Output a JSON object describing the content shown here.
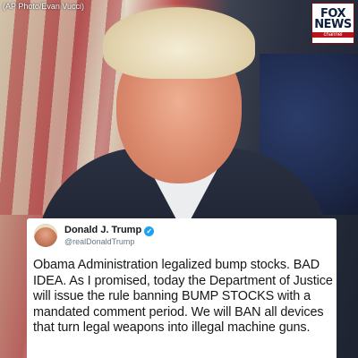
{
  "photo_credit": "(AP Photo/Evan Vucci)",
  "logo": {
    "word": "FOX\nNEWS",
    "line1": "FOX",
    "line2": "NEWS",
    "channel": "channel"
  },
  "tweet": {
    "display_name": "Donald J. Trump",
    "handle": "@realDonaldTrump",
    "verified_icon": "verified-badge-icon",
    "text": "Obama Administration legalized bump stocks. BAD IDEA. As I promised, today the Department of Justice will issue the rule banning BUMP STOCKS with a mandated comment period. We will BAN all devices that turn legal weapons into illegal machine guns."
  },
  "colors": {
    "verified_blue": "#1da1f2",
    "fox_red": "#b8121b",
    "fox_navy": "#0d1f3f"
  }
}
